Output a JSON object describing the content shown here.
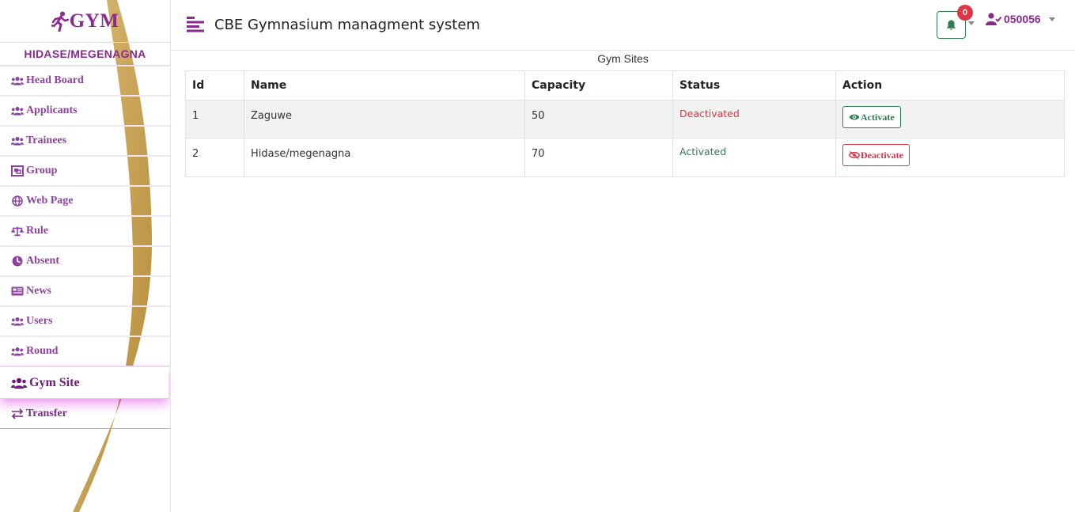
{
  "brand": {
    "text": "GYM"
  },
  "sidebar": {
    "site_name": "HIDASE/MEGENAGNA",
    "items": [
      {
        "label": "Head Board",
        "icon": "users-icon"
      },
      {
        "label": "Applicants",
        "icon": "users-icon"
      },
      {
        "label": "Trainees",
        "icon": "users-icon"
      },
      {
        "label": "Group",
        "icon": "object-group-icon"
      },
      {
        "label": "Web Page",
        "icon": "globe-icon"
      },
      {
        "label": "Rule",
        "icon": "scale-icon"
      },
      {
        "label": "Absent",
        "icon": "clock-icon"
      },
      {
        "label": "News",
        "icon": "newspaper-icon"
      },
      {
        "label": "Users",
        "icon": "users-icon"
      },
      {
        "label": "Round",
        "icon": "users-icon"
      },
      {
        "label": "Gym Site",
        "icon": "users-icon",
        "active": true
      },
      {
        "label": "Transfer",
        "icon": "exchange-icon"
      }
    ]
  },
  "header": {
    "title": "CBE Gymnasium managment system",
    "notification_count": "0",
    "user_id": "050056"
  },
  "table": {
    "caption": "Gym Sites",
    "columns": [
      "Id",
      "Name",
      "Capacity",
      "Status",
      "Action"
    ],
    "rows": [
      {
        "id": "1",
        "name": "Zaguwe",
        "capacity": "50",
        "status": "Deactivated",
        "action": "Activate"
      },
      {
        "id": "2",
        "name": "Hidase/megenagna",
        "capacity": "70",
        "status": "Activated",
        "action": "Deactivate"
      }
    ]
  },
  "colors": {
    "brand_purple": "#8b2a8f",
    "success_green": "#2e7d4f",
    "danger_red": "#dc3545",
    "swoosh_gold": "#c9a24f"
  }
}
